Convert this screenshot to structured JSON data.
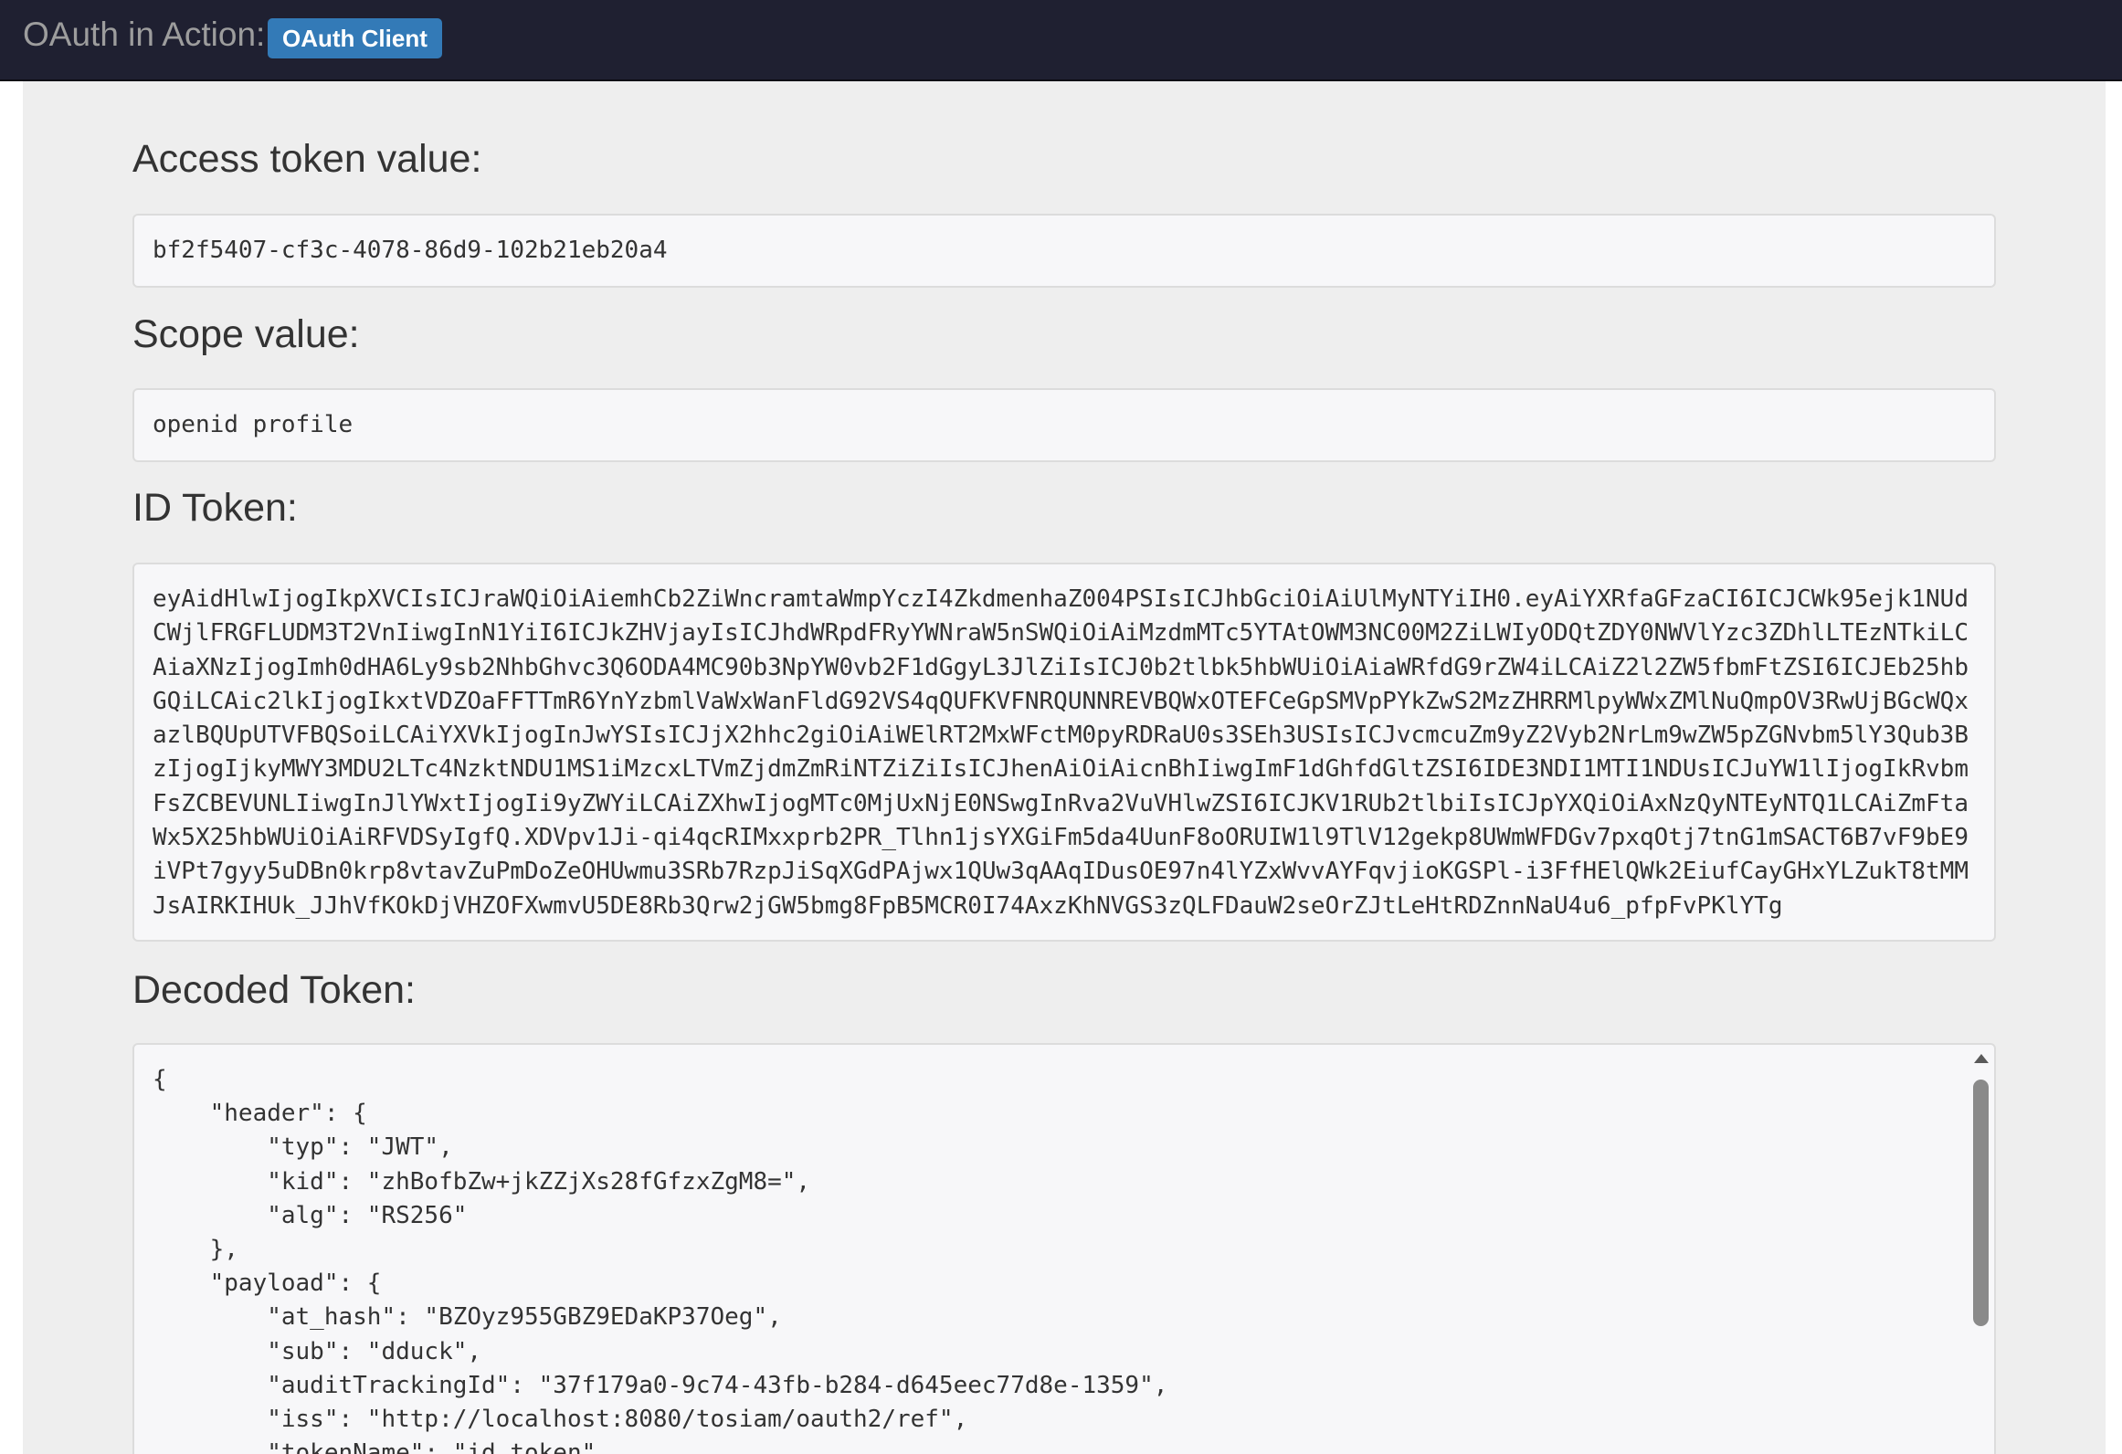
{
  "navbar": {
    "brand": "OAuth in Action:",
    "badge": "OAuth Client"
  },
  "access_token": {
    "label": "Access token value:",
    "value": "bf2f5407-cf3c-4078-86d9-102b21eb20a4"
  },
  "scope": {
    "label": "Scope value:",
    "value": "openid profile"
  },
  "id_token": {
    "label": "ID Token:",
    "value": "eyAidHlwIjogIkpXVCIsICJraWQiOiAiemhCb2ZiWncramtaWmpYczI4ZkdmenhaZ004PSIsICJhbGciOiAiUlMyNTYiIH0.eyAiYXRfaGFzaCI6ICJCWk95ejk1NUdCWjlFRGFLUDM3T2VnIiwgInN1YiI6ICJkZHVjayIsICJhdWRpdFRyYWNraW5nSWQiOiAiMzdmMTc5YTAtOWM3NC00M2ZiLWIyODQtZDY0NWVlYzc3ZDhlLTEzNTkiLCAiaXNzIjogImh0dHA6Ly9sb2NhbGhvc3Q6ODA4MC90b3NpYW0vb2F1dGgyL3JlZiIsICJ0b2tlbk5hbWUiOiAiaWRfdG9rZW4iLCAiZ2l2ZW5fbmFtZSI6ICJEb25hbGQiLCAic2lkIjogIkxtVDZOaFFTTmR6YnYzbmlVaWxWanFldG92VS4qQUFKVFNRQUNNREVBQWxOTEFCeGpSMVpPYkZwS2MzZHRRMlpyWWxZMlNuQmpOV3RwUjBGcWQxazlBQUpUTVFBQSoiLCAiYXVkIjogInJwYSIsICJjX2hhc2giOiAiWElRT2MxWFctM0pyRDRaU0s3SEh3USIsICJvcmcuZm9yZ2Vyb2NrLm9wZW5pZGNvbm5lY3Qub3BzIjogIjkyMWY3MDU2LTc4NzktNDU1MS1iMzcxLTVmZjdmZmRiNTZiZiIsICJhenAiOiAicnBhIiwgImF1dGhfdGltZSI6IDE3NDI1MTI1NDUsICJuYW1lIjogIkRvbmFsZCBEVUNLIiwgInJlYWxtIjogIi9yZWYiLCAiZXhwIjogMTc0MjUxNjE0NSwgInRva2VuVHlwZSI6ICJKV1RUb2tlbiIsICJpYXQiOiAxNzQyNTEyNTQ1LCAiZmFtaWx5X25hbWUiOiAiRFVDSyIgfQ.XDVpv1Ji-qi4qcRIMxxprb2PR_Tlhn1jsYXGiFm5da4UunF8oORUIW1l9TlV12gekp8UWmWFDGv7pxqOtj7tnG1mSACT6B7vF9bE9iVPt7gyy5uDBn0krp8vtavZuPmDoZeOHUwmu3SRb7RzpJiSqXGdPAjwx1QUw3qAAqIDusOE97n4lYZxWvvAYFqvjioKGSPl-i3FfHElQWk2EiufCayGHxYLZukT8tMMJsAIRKIHUk_JJhVfKOkDjVHZOFXwmvU5DE8Rb3Qrw2jGW5bmg8FpB5MCR0I74AxzKhNVGS3zQLFDauW2seOrZJtLeHtRDZnnNaU4u6_pfpFvPKlYTg"
  },
  "decoded": {
    "label": "Decoded Token:",
    "json": "{\n    \"header\": {\n        \"typ\": \"JWT\",\n        \"kid\": \"zhBofbZw+jkZZjXs28fGfzxZgM8=\",\n        \"alg\": \"RS256\"\n    },\n    \"payload\": {\n        \"at_hash\": \"BZOyz955GBZ9EDaKP37Oeg\",\n        \"sub\": \"dduck\",\n        \"auditTrackingId\": \"37f179a0-9c74-43fb-b284-d645eec77d8e-1359\",\n        \"iss\": \"http://localhost:8080/tosiam/oauth2/ref\",\n        \"tokenName\": \"id_token\","
  }
}
